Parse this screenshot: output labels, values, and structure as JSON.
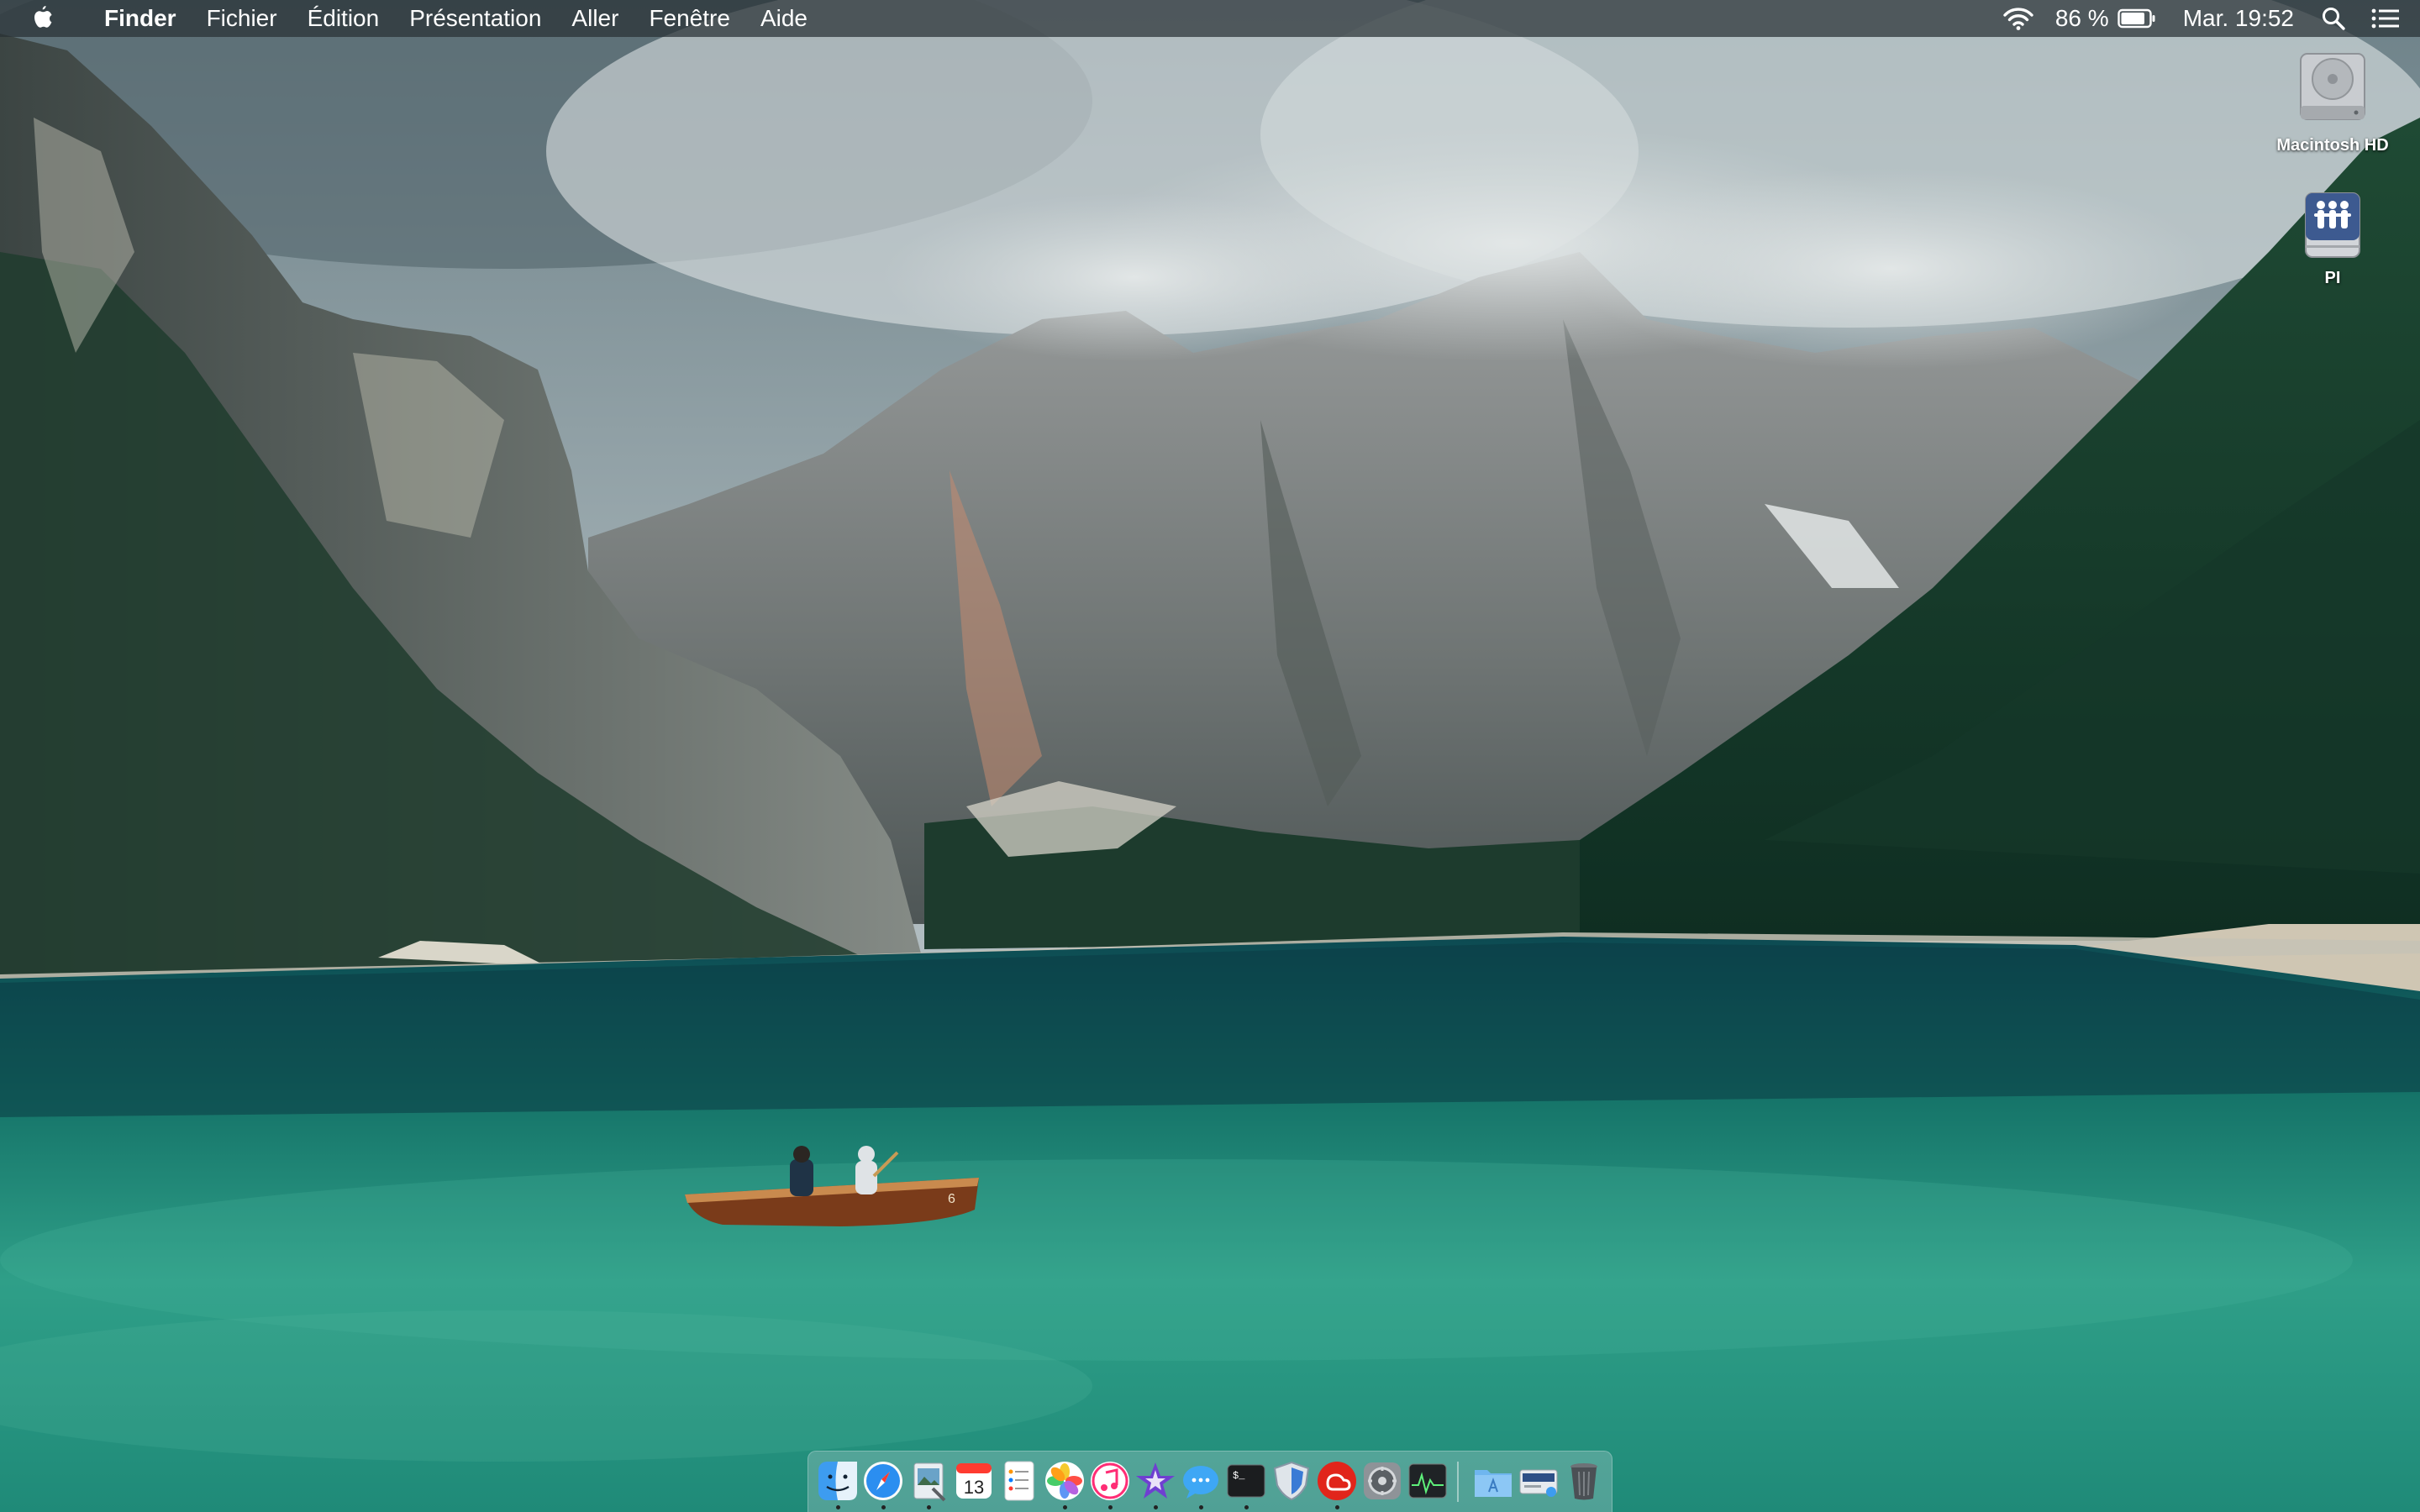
{
  "menubar": {
    "apple_icon": "apple-logo-icon",
    "app_name": "Finder",
    "menus": [
      "Fichier",
      "Édition",
      "Présentation",
      "Aller",
      "Fenêtre",
      "Aide"
    ],
    "battery_percent": "86 %",
    "battery_level": 0.86,
    "clock": "Mar. 19:52",
    "icons": [
      "wifi-icon",
      "battery-icon",
      "spotlight-search-icon",
      "notification-center-icon"
    ]
  },
  "desktop": {
    "icons": [
      {
        "label": "Macintosh HD",
        "icon": "hard-drive-icon"
      },
      {
        "label": "PI",
        "icon": "network-share-icon"
      }
    ]
  },
  "dock": {
    "apps": [
      {
        "icon": "finder-icon",
        "running": true
      },
      {
        "icon": "safari-icon",
        "running": true
      },
      {
        "icon": "preview-icon",
        "running": true
      },
      {
        "icon": "calendar-icon",
        "running": false,
        "text": "13"
      },
      {
        "icon": "reminders-icon",
        "running": false
      },
      {
        "icon": "photos-icon",
        "running": true
      },
      {
        "icon": "itunes-icon",
        "running": true
      },
      {
        "icon": "imovie-icon",
        "running": true
      },
      {
        "icon": "messages-icon",
        "running": true
      },
      {
        "icon": "terminal-icon",
        "running": true
      },
      {
        "icon": "security-shield-icon",
        "running": false
      },
      {
        "icon": "creative-cloud-icon",
        "running": true
      },
      {
        "icon": "system-preferences-icon",
        "running": false
      },
      {
        "icon": "activity-monitor-icon",
        "running": false
      },
      {
        "icon": "applications-folder-icon",
        "running": false
      },
      {
        "icon": "downloads-stack-icon",
        "running": false
      },
      {
        "icon": "trash-icon",
        "running": false
      }
    ]
  }
}
